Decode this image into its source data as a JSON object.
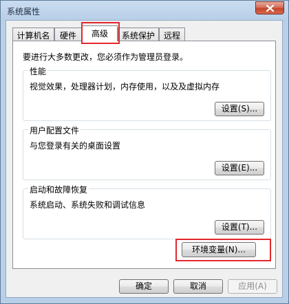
{
  "window": {
    "title": "系统属性",
    "close_icon": "close-icon"
  },
  "tabs": [
    {
      "label": "计算机名",
      "active": false
    },
    {
      "label": "硬件",
      "active": false
    },
    {
      "label": "高级",
      "active": true
    },
    {
      "label": "系统保护",
      "active": false
    },
    {
      "label": "远程",
      "active": false
    }
  ],
  "advanced": {
    "admin_note": "要进行大多数更改，您必须作为管理员登录。",
    "performance": {
      "title": "性能",
      "description": "视觉效果，处理器计划，内存使用，以及及虚拟内存",
      "settings_button": "设置(S)..."
    },
    "user_profiles": {
      "title": "用户配置文件",
      "description": "与您登录有关的桌面设置",
      "settings_button": "设置(E)..."
    },
    "startup_recovery": {
      "title": "启动和故障恢复",
      "description": "系统启动、系统失败和调试信息",
      "settings_button": "设置(T)..."
    },
    "env_vars_button": "环境变量(N)..."
  },
  "footer": {
    "ok": "确定",
    "cancel": "取消",
    "apply": "应用(A)"
  },
  "colors": {
    "highlight": "#e2262b",
    "close_button": "#c2452a"
  }
}
